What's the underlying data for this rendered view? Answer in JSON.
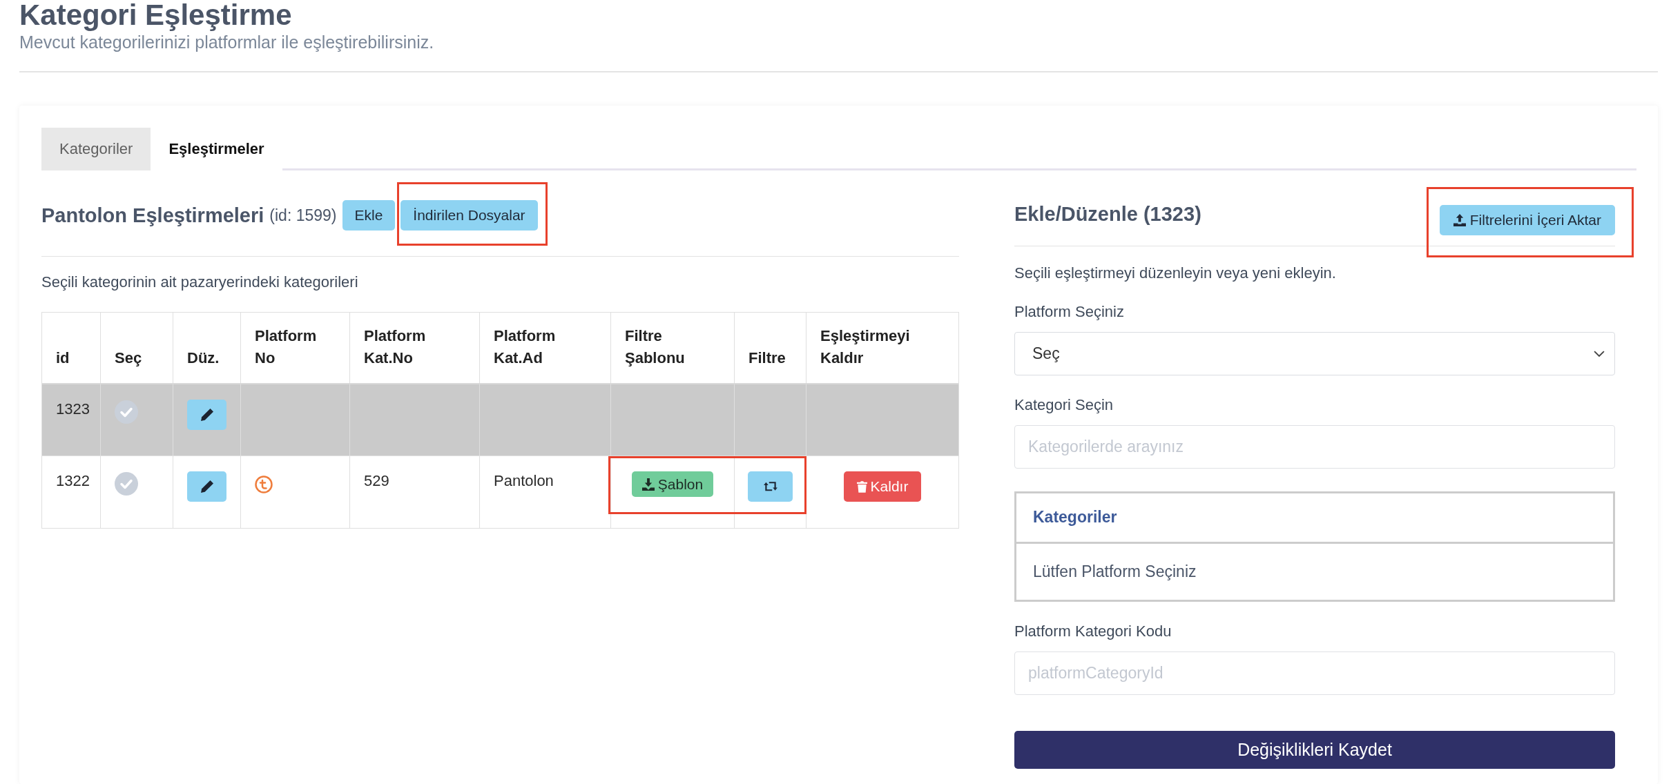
{
  "page": {
    "title": "Kategori Eşleştirme",
    "subtitle": "Mevcut kategorilerinizi platformlar ile eşleştirebilirsiniz."
  },
  "tabs": [
    {
      "label": "Kategoriler",
      "selected": false
    },
    {
      "label": "Eşleştirmeler",
      "selected": true
    }
  ],
  "mappings": {
    "title": "Pantolon Eşleştirmeleri",
    "id_label": "(id: 1599)",
    "buttons": [
      {
        "label": "Ekle",
        "highlighted": false
      },
      {
        "label": "İndirilen Dosyalar",
        "highlighted": true
      }
    ],
    "description": "Seçili kategorinin ait pazaryerindeki kategorileri",
    "table": {
      "columns": [
        "id",
        "Seç",
        "Düz.",
        "Platform No",
        "Platform Kat.No",
        "Platform Kat.Ad",
        "Filtre Şablonu",
        "Filtre",
        "Eşleştirmeyi Kaldır"
      ],
      "rows": [
        {
          "id": "1323",
          "kind": "unmapped",
          "selected": true,
          "actions_highlighted": false
        },
        {
          "id": "1322",
          "kind": "mapped",
          "selected": false,
          "platform_kat_no": "529",
          "platform_kat_ad": "Pantolon",
          "template_button": "Şablon",
          "remove_button": "Kaldır",
          "actions_highlighted": true
        }
      ]
    }
  },
  "editor": {
    "title": "Ekle/Düzenle (1323)",
    "import_button": {
      "label": "Filtrelerini İçeri Aktar",
      "highlighted": true
    },
    "description": "Seçili eşleştirmeyi düzenleyin veya yeni ekleyin.",
    "fields": [
      {
        "kind": "select",
        "label": "Platform Seçiniz",
        "value": "Seç"
      },
      {
        "kind": "input",
        "label": "Kategori Seçin",
        "placeholder": "Kategorilerde arayınız"
      },
      {
        "kind": "list",
        "header": "Kategoriler",
        "items": [
          "Lütfen Platform Seçiniz"
        ]
      },
      {
        "kind": "input",
        "label": "Platform Kategori Kodu",
        "placeholder": "platformCategoryId"
      }
    ],
    "save_button": "Değişiklikleri Kaydet"
  }
}
